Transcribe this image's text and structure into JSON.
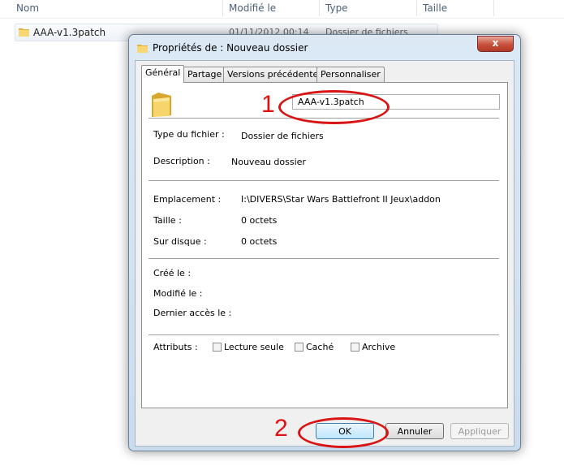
{
  "explorer": {
    "columns": {
      "name": "Nom",
      "modified": "Modifié le",
      "type": "Type",
      "size": "Taille"
    },
    "row": {
      "name": "AAA-v1.3patch",
      "modified": "01/11/2012 00:14",
      "type": "Dossier de fichiers"
    }
  },
  "dialog": {
    "title": "Propriétés de : Nouveau dossier",
    "close_glyph": "x",
    "tabs": [
      "Général",
      "Partage",
      "Versions précédentes",
      "Personnaliser"
    ],
    "name_value": "AAA-v1.3patch",
    "fields": {
      "type_label": "Type du fichier :",
      "type_value": "Dossier de fichiers",
      "description_label": "Description :",
      "description_value": "Nouveau dossier",
      "location_label": "Emplacement :",
      "location_value": "I:\\DIVERS\\Star Wars Battlefront II Jeux\\addon",
      "size_label": "Taille :",
      "size_value": "0 octets",
      "ondisk_label": "Sur disque :",
      "ondisk_value": "0 octets",
      "created_label": "Créé le :",
      "modified_label": "Modifié le :",
      "accessed_label": "Dernier accès le :"
    },
    "attributes": {
      "label": "Attributs :",
      "readonly": "Lecture seule",
      "hidden": "Caché",
      "archive": "Archive"
    },
    "buttons": {
      "ok": "OK",
      "cancel": "Annuler",
      "apply": "Appliquer"
    }
  },
  "annotations": {
    "one": "1",
    "two": "2"
  },
  "colors": {
    "annotation_red": "#d91414",
    "folder_yellow": "#f2c94c"
  }
}
